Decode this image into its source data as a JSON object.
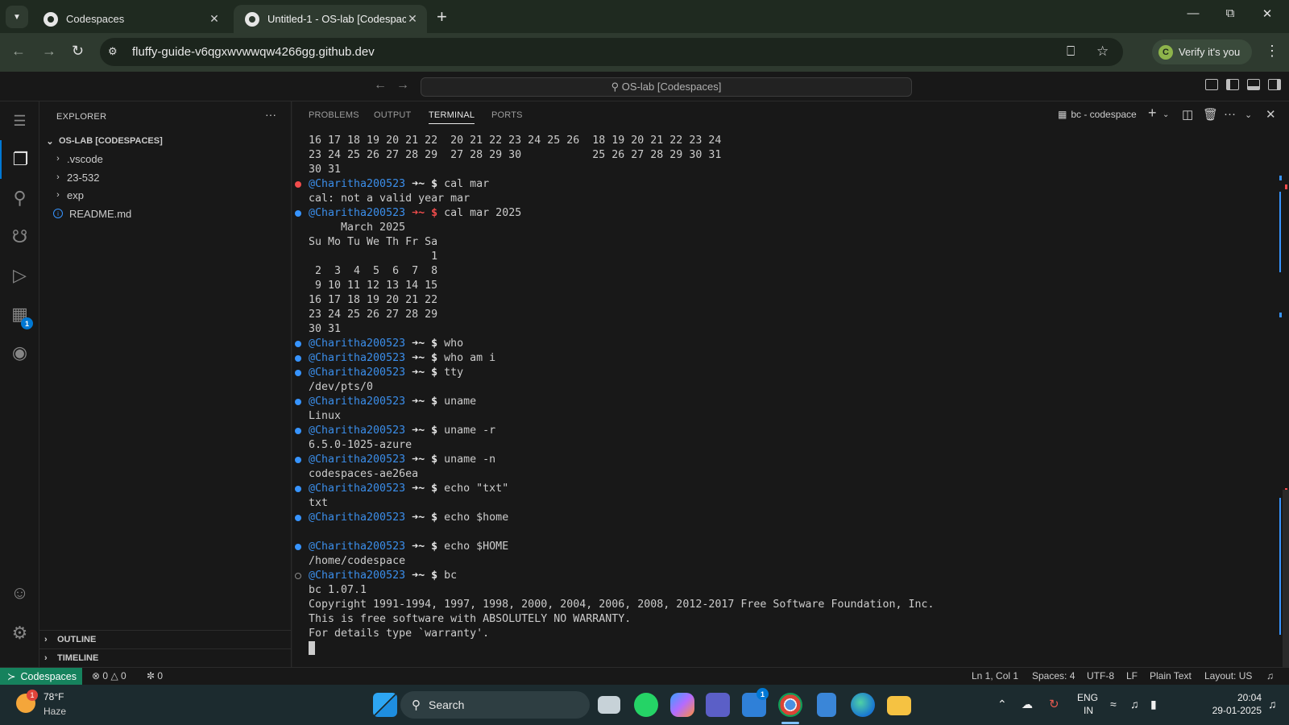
{
  "browser": {
    "tabs": [
      {
        "title": "Codespaces",
        "active": false
      },
      {
        "title": "Untitled-1 - OS-lab [Codespaces]",
        "active": true
      }
    ],
    "url": "fluffy-guide-v6qgxwvwwqw4266gg.github.dev",
    "verify_label": "Verify it's you",
    "verify_avatar": "C"
  },
  "vscode": {
    "command_center": "OS-lab [Codespaces]",
    "explorer": {
      "title": "EXPLORER",
      "root": "OS-LAB [CODESPACES]",
      "items": [
        {
          "label": ".vscode",
          "type": "folder"
        },
        {
          "label": "23-532",
          "type": "folder"
        },
        {
          "label": "exp",
          "type": "folder"
        },
        {
          "label": "README.md",
          "type": "file"
        }
      ],
      "sections": [
        "OUTLINE",
        "TIMELINE"
      ]
    },
    "activity_badge": "1",
    "panel": {
      "tabs": [
        "PROBLEMS",
        "OUTPUT",
        "TERMINAL",
        "PORTS"
      ],
      "active_tab": "TERMINAL",
      "terminal_name": "bc - codespace"
    },
    "terminal_lines": [
      {
        "kind": "out",
        "text": "16 17 18 19 20 21 22  20 21 22 23 24 25 26  18 19 20 21 22 23 24"
      },
      {
        "kind": "out",
        "text": "23 24 25 26 27 28 29  27 28 29 30           25 26 27 28 29 30 31"
      },
      {
        "kind": "out",
        "text": "30 31"
      },
      {
        "kind": "cmd",
        "status": "err",
        "user": "@Charitha200523",
        "cmd": "cal mar",
        "red": false
      },
      {
        "kind": "out",
        "text": "cal: not a valid year mar"
      },
      {
        "kind": "cmd",
        "status": "ok",
        "user": "@Charitha200523",
        "cmd": "cal mar 2025",
        "red": true
      },
      {
        "kind": "out",
        "text": "     March 2025"
      },
      {
        "kind": "out",
        "text": "Su Mo Tu We Th Fr Sa"
      },
      {
        "kind": "out",
        "text": "                   1"
      },
      {
        "kind": "out",
        "text": " 2  3  4  5  6  7  8"
      },
      {
        "kind": "out",
        "text": " 9 10 11 12 13 14 15"
      },
      {
        "kind": "out",
        "text": "16 17 18 19 20 21 22"
      },
      {
        "kind": "out",
        "text": "23 24 25 26 27 28 29"
      },
      {
        "kind": "out",
        "text": "30 31"
      },
      {
        "kind": "cmd",
        "status": "ok",
        "user": "@Charitha200523",
        "cmd": "who",
        "red": false
      },
      {
        "kind": "cmd",
        "status": "ok",
        "user": "@Charitha200523",
        "cmd": "who am i",
        "red": false
      },
      {
        "kind": "cmd",
        "status": "ok",
        "user": "@Charitha200523",
        "cmd": "tty",
        "red": false
      },
      {
        "kind": "out",
        "text": "/dev/pts/0"
      },
      {
        "kind": "cmd",
        "status": "ok",
        "user": "@Charitha200523",
        "cmd": "uname",
        "red": false
      },
      {
        "kind": "out",
        "text": "Linux"
      },
      {
        "kind": "cmd",
        "status": "ok",
        "user": "@Charitha200523",
        "cmd": "uname -r",
        "red": false
      },
      {
        "kind": "out",
        "text": "6.5.0-1025-azure"
      },
      {
        "kind": "cmd",
        "status": "ok",
        "user": "@Charitha200523",
        "cmd": "uname -n",
        "red": false
      },
      {
        "kind": "out",
        "text": "codespaces-ae26ea"
      },
      {
        "kind": "cmd",
        "status": "ok",
        "user": "@Charitha200523",
        "cmd": "echo \"txt\"",
        "red": false
      },
      {
        "kind": "out",
        "text": "txt"
      },
      {
        "kind": "cmd",
        "status": "ok",
        "user": "@Charitha200523",
        "cmd": "echo $home",
        "red": false
      },
      {
        "kind": "out",
        "text": ""
      },
      {
        "kind": "cmd",
        "status": "ok",
        "user": "@Charitha200523",
        "cmd": "echo $HOME",
        "red": false
      },
      {
        "kind": "out",
        "text": "/home/codespace"
      },
      {
        "kind": "cmd",
        "status": "pend",
        "user": "@Charitha200523",
        "cmd": "bc",
        "red": false
      },
      {
        "kind": "out",
        "text": "bc 1.07.1"
      },
      {
        "kind": "out",
        "text": "Copyright 1991-1994, 1997, 1998, 2000, 2004, 2006, 2008, 2012-2017 Free Software Foundation, Inc."
      },
      {
        "kind": "out",
        "text": "This is free software with ABSOLUTELY NO WARRANTY."
      },
      {
        "kind": "out",
        "text": "For details type `warranty'."
      },
      {
        "kind": "cursor",
        "text": ""
      }
    ],
    "prompt_suffix": " ➜~ $ ",
    "status_bar": {
      "remote": "Codespaces",
      "errors": "0",
      "warnings": "0",
      "ports": "0",
      "position": "Ln 1, Col 1",
      "spaces": "Spaces: 4",
      "encoding": "UTF-8",
      "eol": "LF",
      "language": "Plain Text",
      "layout": "Layout: US"
    }
  },
  "taskbar": {
    "temperature": "78°F",
    "condition": "Haze",
    "weather_badge": "1",
    "search_label": "Search",
    "language": "ENG",
    "region": "IN",
    "time": "20:04",
    "date": "29-01-2025",
    "teams_badge": "1"
  }
}
